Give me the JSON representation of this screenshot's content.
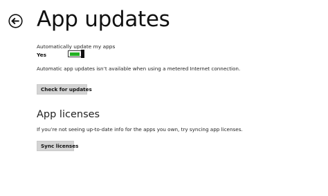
{
  "header": {
    "title": "App updates",
    "back_icon": "back-arrow-circle-icon"
  },
  "updates": {
    "auto_update_label": "Automatically update my apps",
    "auto_update_state": "Yes",
    "auto_update_on": true,
    "toggle_color": "#23b023",
    "metered_note": "Automatic app updates isn’t available when using a metered Internet connection.",
    "check_button_label": "Check for updates"
  },
  "licenses": {
    "title": "App licenses",
    "note": "If you’re not seeing up-to-date info for the apps you own, try syncing app licenses.",
    "sync_button_label": "Sync licenses"
  }
}
